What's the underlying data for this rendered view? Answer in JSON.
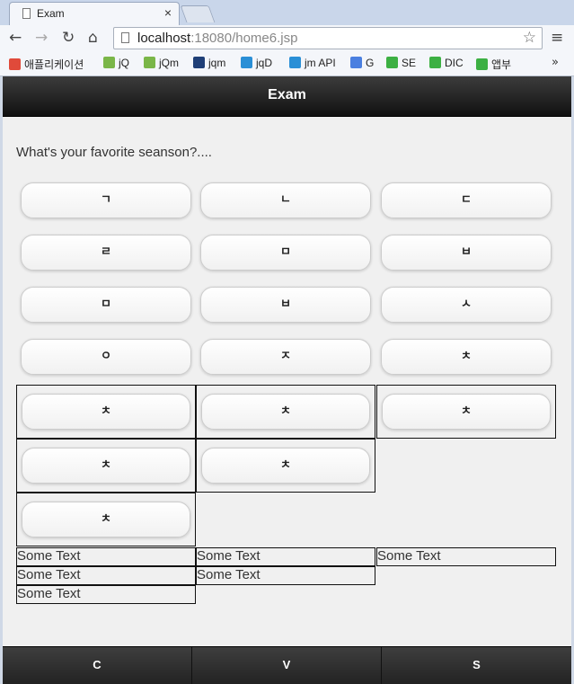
{
  "browser": {
    "tab_title": "Exam",
    "tab_close": "×",
    "url_host": "localhost",
    "url_rest": ":18080/home6.jsp",
    "bookmarks": [
      {
        "label": "애플리케이션",
        "color": "#e04a3a"
      },
      {
        "label": "jQ",
        "color": "#7ab648"
      },
      {
        "label": "jQm",
        "color": "#7ab648"
      },
      {
        "label": "jqm",
        "color": "#1f3f77"
      },
      {
        "label": "jqD",
        "color": "#2a8fd6"
      },
      {
        "label": "jm API",
        "color": "#2a8fd6"
      },
      {
        "label": "G",
        "color": "#4a7fe0"
      },
      {
        "label": "SE",
        "color": "#3cb043"
      },
      {
        "label": "DIC",
        "color": "#3cb043"
      },
      {
        "label": "앱부",
        "color": "#3cb043"
      }
    ],
    "more": "»"
  },
  "page": {
    "header_title": "Exam",
    "question": "What's your favorite seanson?....",
    "grid_buttons": [
      "ㄱ",
      "ㄴ",
      "ㄷ",
      "ㄹ",
      "ㅁ",
      "ㅂ",
      "ㅁ",
      "ㅂ",
      "ㅅ",
      "ㅇ",
      "ㅈ",
      "ㅊ"
    ],
    "bordered_buttons": [
      "ㅊ",
      "ㅊ",
      "ㅊ",
      "ㅊ",
      "ㅊ",
      "ㅊ"
    ],
    "text_cells": [
      "Some Text",
      "Some Text",
      "Some Text",
      "Some Text",
      "Some Text",
      "Some Text"
    ],
    "footer_buttons": [
      "C",
      "V",
      "S"
    ]
  }
}
